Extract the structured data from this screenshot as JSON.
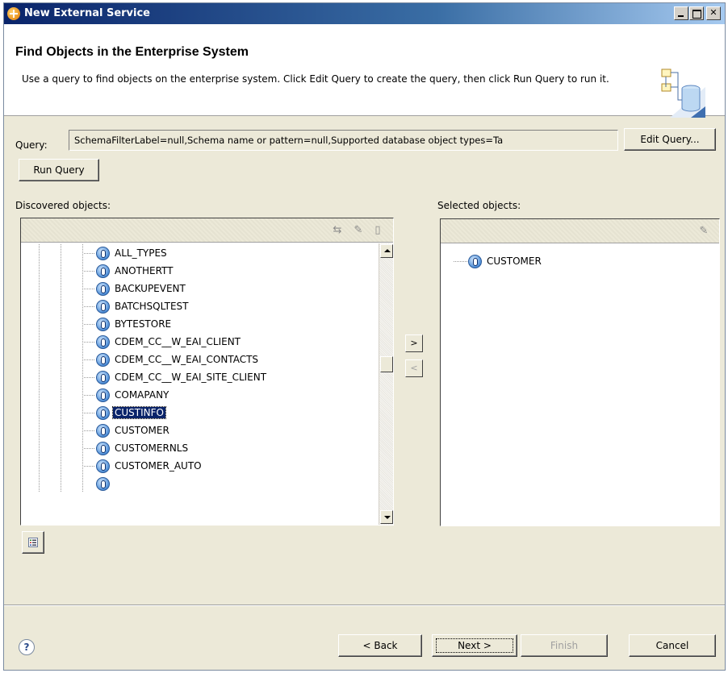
{
  "window": {
    "title": "New External Service"
  },
  "header": {
    "title": "Find Objects in the Enterprise System",
    "description": "Use a query to find objects on the enterprise system.  Click Edit Query to create the query, then click Run Query to run it."
  },
  "query": {
    "label": "Query:",
    "value": "SchemaFilterLabel=null,Schema name or pattern=null,Supported database object types=Ta",
    "edit_button": "Edit Query...",
    "run_button": "Run Query"
  },
  "discovered": {
    "label": "Discovered objects:",
    "items": [
      "ALL_TYPES",
      "ANOTHERTT",
      "BACKUPEVENT",
      "BATCHSQLTEST",
      "BYTESTORE",
      "CDEM_CC__W_EAI_CLIENT",
      "CDEM_CC__W_EAI_CONTACTS",
      "CDEM_CC__W_EAI_SITE_CLIENT",
      "COMAPANY",
      "CUSTINFO",
      "CUSTOMER",
      "CUSTOMERNLS",
      "CUSTOMER_AUTO"
    ],
    "selected_item": "CUSTINFO"
  },
  "selected": {
    "label": "Selected objects:",
    "items": [
      "CUSTOMER"
    ]
  },
  "transfer": {
    "add": ">",
    "remove": "<"
  },
  "footer": {
    "help": "?",
    "back": "< Back",
    "next": "Next >",
    "finish": "Finish",
    "cancel": "Cancel"
  },
  "colors": {
    "title_bar": "#0a246a",
    "selection": "#0a246a",
    "dialog_bg": "#ece9d8"
  }
}
